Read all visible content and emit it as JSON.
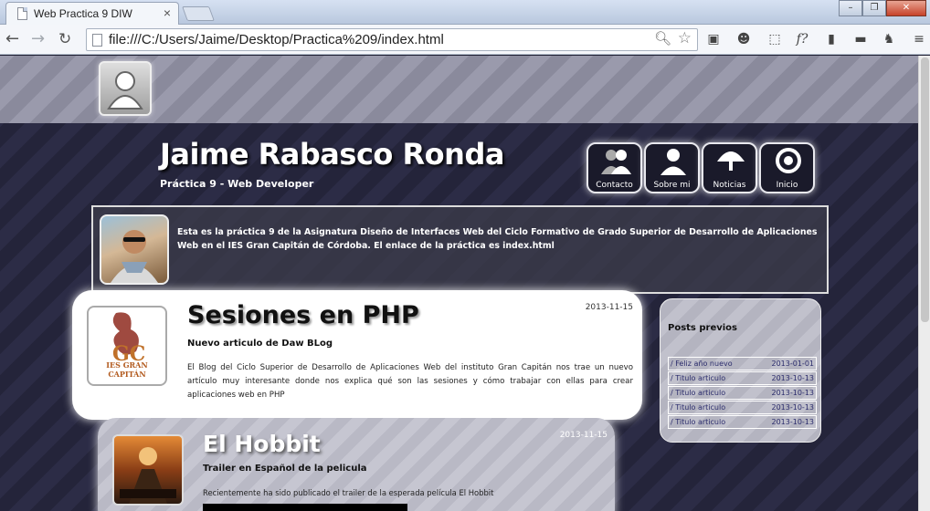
{
  "browser": {
    "tab_title": "Web Practica 9 DIW",
    "tab_close": "×",
    "url": "file:///C:/Users/Jaime/Desktop/Practica%209/index.html",
    "back": "←",
    "forward": "→",
    "reload": "↻",
    "window_min": "–",
    "window_max": "❐",
    "window_close": "✕",
    "ext_script": "f?"
  },
  "header": {
    "title": "Jaime Rabasco Ronda",
    "subtitle": "Práctica 9 - Web Developer"
  },
  "nav": {
    "items": [
      {
        "label": "Contacto"
      },
      {
        "label": "Sobre mi"
      },
      {
        "label": "Noticias"
      },
      {
        "label": "Inicio"
      }
    ]
  },
  "intro": {
    "text": "Esta es la práctica 9 de la Asignatura Diseño de Interfaces Web del Ciclo Formativo de Grado Superior de Desarrollo de Aplicaciones Web en el IES Gran Capitán de Córdoba. El enlace de la práctica es index.html"
  },
  "posts": [
    {
      "title": "Sesiones en PHP",
      "subtitle": "Nuevo articulo de Daw BLog",
      "date": "2013-11-15",
      "logo_text": "IES GRAN CAPITÁN",
      "body": "El Blog del Ciclo Superior de Desarrollo de Aplicaciones Web del instituto Gran Capitán nos trae un nuevo artículo muy interesante donde nos explica qué son las sesiones y cómo trabajar con ellas para crear aplicaciones web en PHP"
    },
    {
      "title": "El Hobbit",
      "subtitle": "Trailer en Español de la pelicula",
      "date": "2013-11-15",
      "body": "Recientemente ha sido publicado el trailer de la esperada película El Hobbit"
    }
  ],
  "sidebar": {
    "title": "Posts previos",
    "items": [
      {
        "title": "/ Feliz año nuevo",
        "date": "2013-01-01"
      },
      {
        "title": "/ Titulo articulo",
        "date": "2013-10-13"
      },
      {
        "title": "/ Titulo articulo",
        "date": "2013-10-13"
      },
      {
        "title": "/ Titulo articulo",
        "date": "2013-10-13"
      },
      {
        "title": "/ Titulo articulo",
        "date": "2013-10-13"
      }
    ]
  }
}
